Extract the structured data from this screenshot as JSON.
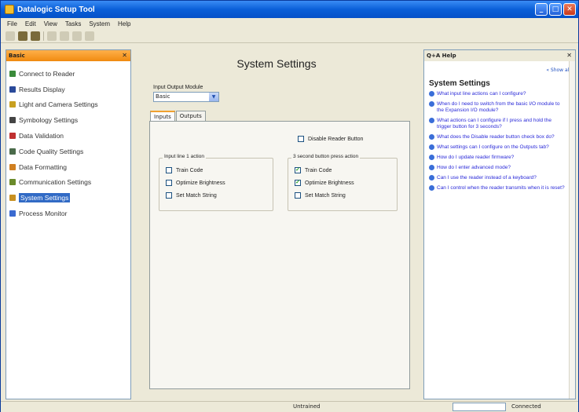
{
  "window": {
    "title": "Datalogic Setup Tool"
  },
  "menu": [
    "File",
    "Edit",
    "View",
    "Tasks",
    "System",
    "Help"
  ],
  "left_pane": {
    "header": "Basic",
    "items": [
      {
        "label": "Connect to Reader",
        "icon": "connect-icon",
        "color": "#3a8a3a"
      },
      {
        "label": "Results Display",
        "icon": "results-icon",
        "color": "#2a4a9a"
      },
      {
        "label": "Light and Camera Settings",
        "icon": "camera-icon",
        "color": "#c8a020"
      },
      {
        "label": "Symbology Settings",
        "icon": "symbology-icon",
        "color": "#444444"
      },
      {
        "label": "Data Validation",
        "icon": "validation-icon",
        "color": "#c03030"
      },
      {
        "label": "Code Quality Settings",
        "icon": "quality-icon",
        "color": "#4a6a4a"
      },
      {
        "label": "Data Formatting",
        "icon": "formatting-icon",
        "color": "#d08020"
      },
      {
        "label": "Communication Settings",
        "icon": "communication-icon",
        "color": "#6a8a2a"
      },
      {
        "label": "System Settings",
        "icon": "system-icon",
        "color": "#c89020",
        "selected": true
      },
      {
        "label": "Process Monitor",
        "icon": "monitor-icon",
        "color": "#3a6ad0"
      }
    ]
  },
  "main": {
    "title": "System Settings",
    "io_module_label": "Input Output Module",
    "io_module_value": "Basic",
    "tabs": [
      "Inputs",
      "Outputs"
    ],
    "active_tab": "Inputs",
    "disable_button": "Disable Reader Button",
    "group1": {
      "legend": "Input line 1 action",
      "items": [
        {
          "label": "Train Code",
          "checked": false
        },
        {
          "label": "Optimize Brightness",
          "checked": false
        },
        {
          "label": "Set Match String",
          "checked": false
        }
      ]
    },
    "group2": {
      "legend": "3 second button press action",
      "items": [
        {
          "label": "Train Code",
          "checked": true
        },
        {
          "label": "Optimize Brightness",
          "checked": true
        },
        {
          "label": "Set Match String",
          "checked": false
        }
      ]
    }
  },
  "help": {
    "header": "Q+A Help",
    "show_all": "« Show all",
    "title": "System Settings",
    "questions": [
      "What input line actions can I configure?",
      "When do I need to switch from the basic I/O module to the Expansion I/O module?",
      "What actions can I configure if I press and hold the trigger button for 3 seconds?",
      "What does the Disable reader button check box do?",
      "What settings can I configure on the Outputs tab?",
      "How do I update reader firmware?",
      "How do I enter advanced mode?",
      "Can I use the reader instead of a keyboard?",
      "Can I control when the reader transmits when it is reset?"
    ]
  },
  "status": {
    "center": "Untrained",
    "right": "Connected"
  }
}
